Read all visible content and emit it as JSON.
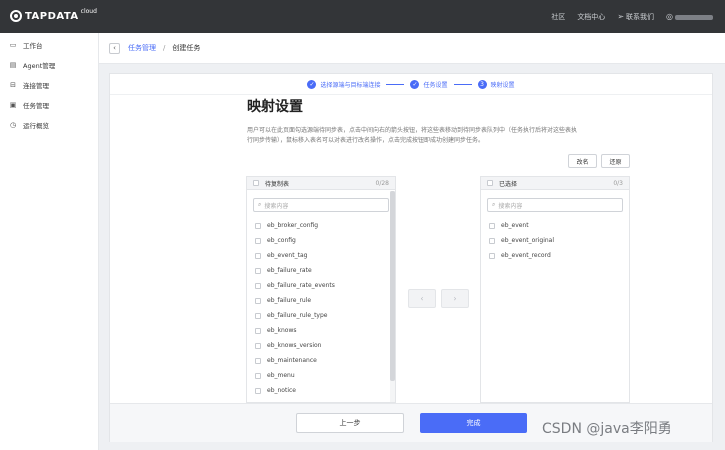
{
  "topbar": {
    "logo_text": "TAPDATA",
    "logo_sub": "cloud",
    "nav": [
      "社区",
      "文档中心",
      "联系我们"
    ]
  },
  "sidebar": {
    "items": [
      {
        "label": "工作台",
        "icon": "desktop-icon"
      },
      {
        "label": "Agent管理",
        "icon": "agent-icon"
      },
      {
        "label": "连接管理",
        "icon": "connection-icon"
      },
      {
        "label": "任务管理",
        "icon": "task-icon"
      },
      {
        "label": "运行概览",
        "icon": "clock-icon"
      }
    ]
  },
  "breadcrumb": {
    "parent": "任务管理",
    "separator": "/",
    "current": "创建任务"
  },
  "steps": [
    {
      "num": "✓",
      "label": "选择源端与目标端连接"
    },
    {
      "num": "✓",
      "label": "任务设置"
    },
    {
      "num": "3",
      "label": "映射设置"
    }
  ],
  "main": {
    "title": "映射设置",
    "description": "用户可以在此页面勾选源端待同步表，点击中间向右的箭头按钮，将这些表移动到待同步表队列中（任务执行后将对这些表执行同步传输），鼠标移入表名可以对表进行改名操作，点击完成按钮即成功创建同步任务。",
    "rename_btn": "改名",
    "restore_btn": "还原"
  },
  "left_panel": {
    "title": "待复制表",
    "count": "0/28",
    "search_placeholder": "搜索内容",
    "items": [
      "eb_broker_config",
      "eb_config",
      "eb_event_tag",
      "eb_failure_rate",
      "eb_failure_rate_events",
      "eb_failure_rule",
      "eb_failure_rule_type",
      "eb_knows",
      "eb_knows_version",
      "eb_maintenance",
      "eb_menu",
      "eb_notice"
    ]
  },
  "right_panel": {
    "title": "已选择",
    "count": "0/3",
    "search_placeholder": "搜索内容",
    "items": [
      "eb_event",
      "eb_event_original",
      "eb_event_record"
    ]
  },
  "footer": {
    "prev": "上一步",
    "done": "完成"
  },
  "watermark": "CSDN @java李阳勇",
  "colors": {
    "accent": "#4a6cf7",
    "topbar": "#333538"
  }
}
